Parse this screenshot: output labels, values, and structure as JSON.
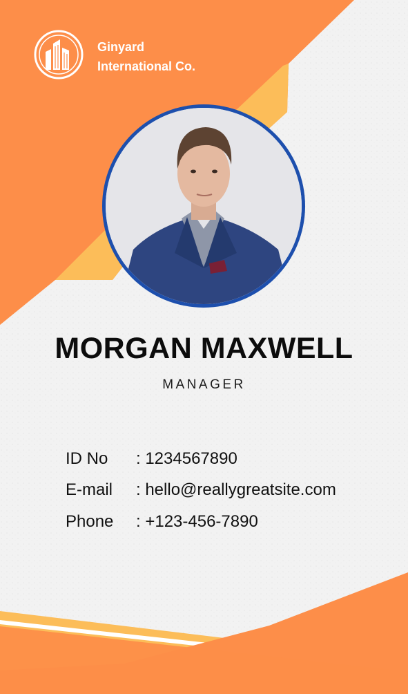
{
  "company": {
    "line1": "Ginyard",
    "line2": "International Co.",
    "logo_icon": "building-logo-icon"
  },
  "person": {
    "name": "MORGAN MAXWELL",
    "role": "MANAGER",
    "photo": "portrait-photo"
  },
  "details": [
    {
      "label": "ID No",
      "value": ": 1234567890"
    },
    {
      "label": "E-mail",
      "value": ": hello@reallygreatsite.com"
    },
    {
      "label": "Phone",
      "value": ": +123-456-7890"
    }
  ],
  "colors": {
    "primary_orange": "#fd8e49",
    "light_orange": "#fcbd59",
    "frame_blue": "#1d4fad",
    "background": "#f1f1f1"
  }
}
